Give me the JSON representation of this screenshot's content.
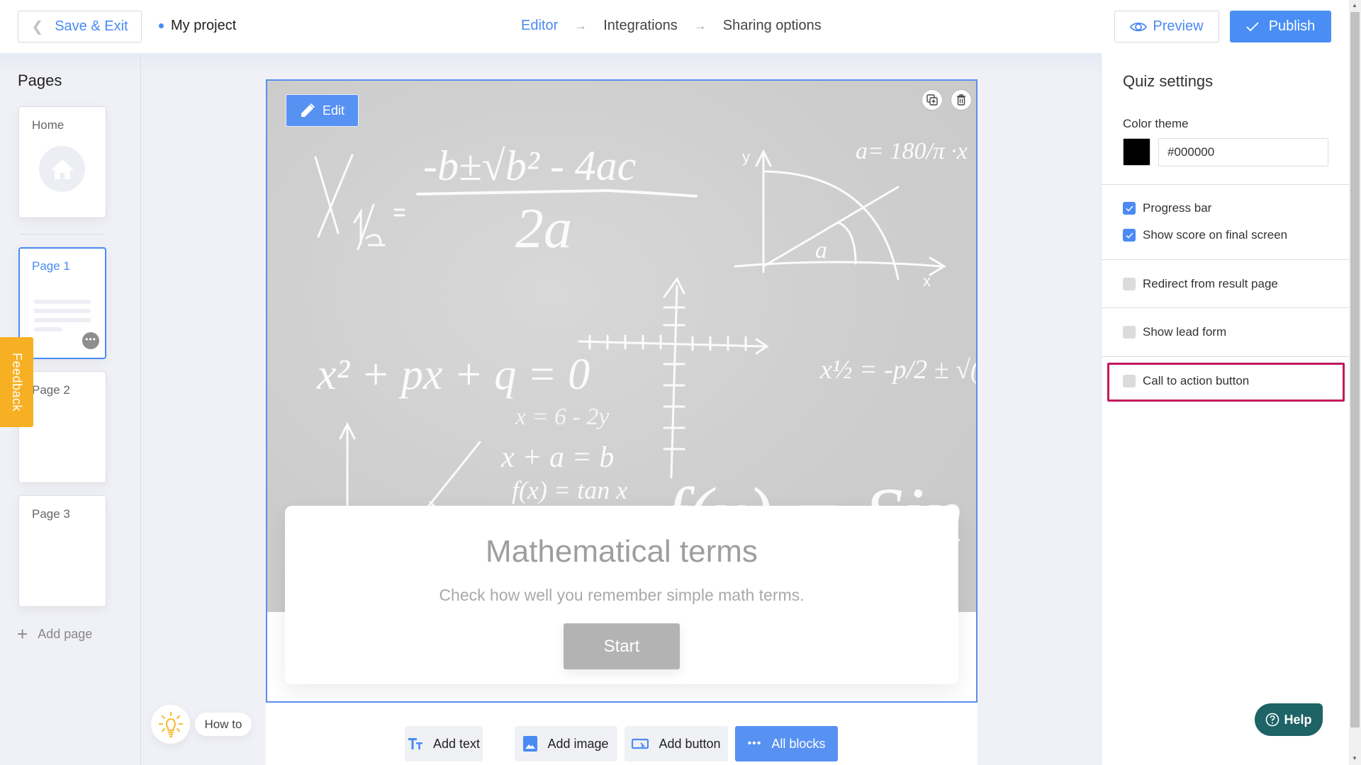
{
  "header": {
    "save_exit_label": "Save & Exit",
    "project_name": "My project",
    "steps": [
      {
        "label": "Editor",
        "active": true
      },
      {
        "label": "Integrations",
        "active": false
      },
      {
        "label": "Sharing options",
        "active": false
      }
    ],
    "step_arrow": "→",
    "preview_label": "Preview",
    "publish_label": "Publish"
  },
  "sidebar": {
    "title": "Pages",
    "pages": [
      {
        "label": "Home",
        "icon": "home-icon"
      },
      {
        "label": "Page 1",
        "active": true
      },
      {
        "label": "Page 2"
      },
      {
        "label": "Page 3"
      }
    ],
    "more_glyph": "•••",
    "add_page_label": "Add page",
    "feedback_label": "Feedback"
  },
  "canvas": {
    "edit_label": "Edit",
    "intro": {
      "title": "Mathematical terms",
      "subtitle": "Check how well you remember simple math terms.",
      "start_label": "Start"
    },
    "blocks": {
      "add_text": "Add text",
      "add_image": "Add image",
      "add_button": "Add button",
      "all_blocks": "All blocks",
      "dots": "•••"
    },
    "how_to_label": "How to"
  },
  "right_panel": {
    "title": "Quiz settings",
    "color_theme_label": "Color theme",
    "color_value": "#000000",
    "options": [
      {
        "label": "Progress bar",
        "checked": true
      },
      {
        "label": "Show score on final screen",
        "checked": true
      },
      {
        "label": "Redirect from result page",
        "checked": false
      },
      {
        "label": "Show lead form",
        "checked": false
      },
      {
        "label": "Call to action button",
        "checked": false,
        "highlighted": true
      }
    ],
    "help_label": "Help"
  },
  "colors": {
    "accent": "#4a8af4",
    "publish_bg": "#4a8ef5",
    "feedback_bg": "#f7b023",
    "help_bg": "#1e6366",
    "highlight": "#c2185b",
    "start_btn": "#b3b3b3"
  }
}
